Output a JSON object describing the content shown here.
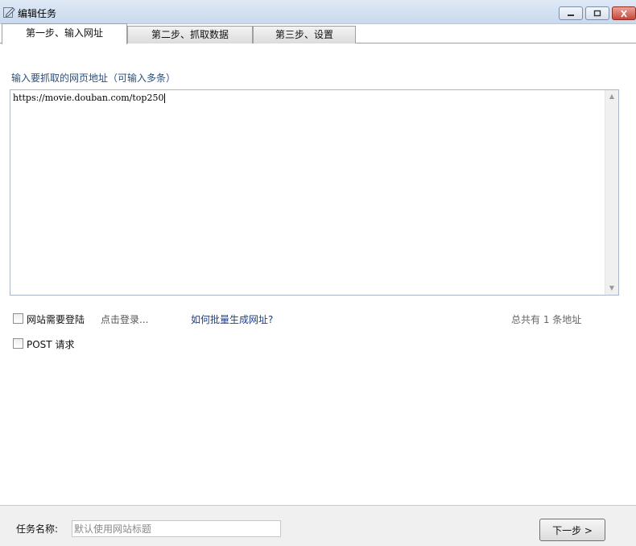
{
  "window": {
    "title": "编辑任务",
    "icon": "pencil-icon",
    "controls": [
      "minimize-icon",
      "maximize-icon",
      "close-icon"
    ]
  },
  "tabs": [
    {
      "label": "第一步、输入网址",
      "active": true
    },
    {
      "label": "第二步、抓取数据",
      "active": false
    },
    {
      "label": "第三步、设置",
      "active": false
    }
  ],
  "url_section": {
    "label": "输入要抓取的网页地址（可输入多条）",
    "value": "https://movie.douban.com/top250"
  },
  "options": {
    "login_checkbox_label": "网站需要登陆",
    "login_checked": false,
    "login_link": "点击登录...",
    "batch_link": "如何批量生成网址?",
    "url_count_text": "总共有 1 条地址",
    "post_checkbox_label": "POST 请求",
    "post_checked": false
  },
  "footer": {
    "name_label": "任务名称:",
    "name_placeholder": "默认使用网站标题",
    "name_value": "",
    "next_button": "下一步 >"
  },
  "colors": {
    "titlebar": "#c9d9ee",
    "label_blue": "#2c4f7a",
    "link_blue": "#1b3f8a",
    "close_red": "#c8473a"
  }
}
